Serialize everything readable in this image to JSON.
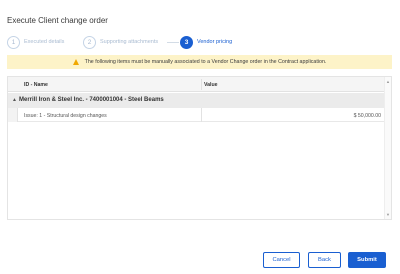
{
  "dialog": {
    "title": "Execute Client change order"
  },
  "stepper": {
    "steps": [
      {
        "number": "1",
        "label": "Executed details"
      },
      {
        "number": "2",
        "label": "Supporting attachments"
      },
      {
        "number": "3",
        "label": "Vendor pricing"
      }
    ]
  },
  "warning": {
    "text": "The following items must be manually associated to a Vendor Change order in the Contract application."
  },
  "table": {
    "columns": {
      "id_name": "ID - Name",
      "value": "Value"
    },
    "group": {
      "caret": "▲",
      "label": "Merrill Iron & Steel Inc. - 7400001004 - Steel Beams"
    },
    "rows": [
      {
        "name": "Issue: 1 - Structural design changes",
        "value": "$ 50,000.00"
      }
    ],
    "scroll_up": "▲",
    "scroll_down": "▼"
  },
  "actions": {
    "cancel": "Cancel",
    "back": "Back",
    "submit": "Submit"
  },
  "colors": {
    "accent": "#1a5fd1",
    "warning_bg": "#fdf3c8",
    "warning_icon": "#f0a800"
  }
}
